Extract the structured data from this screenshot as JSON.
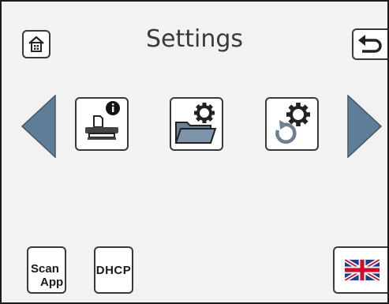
{
  "header": {
    "title": "Settings",
    "home_icon": "home-icon",
    "back_icon": "back-arrow-icon"
  },
  "carousel": {
    "items": [
      {
        "icon": "scanner-info-icon"
      },
      {
        "icon": "folder-settings-icon"
      },
      {
        "icon": "reset-settings-icon"
      }
    ],
    "prev_icon": "triangle-left-icon",
    "next_icon": "triangle-right-icon"
  },
  "footer": {
    "scan_app_line1": "Scan",
    "scan_app_line2": "App",
    "dhcp_label": "DHCP",
    "language_icon": "uk-flag-icon"
  },
  "colors": {
    "arrow_fill": "#607d97",
    "icon_dark": "#222222",
    "folder_fill": "#6c8093",
    "background": "#f2f2f2"
  }
}
